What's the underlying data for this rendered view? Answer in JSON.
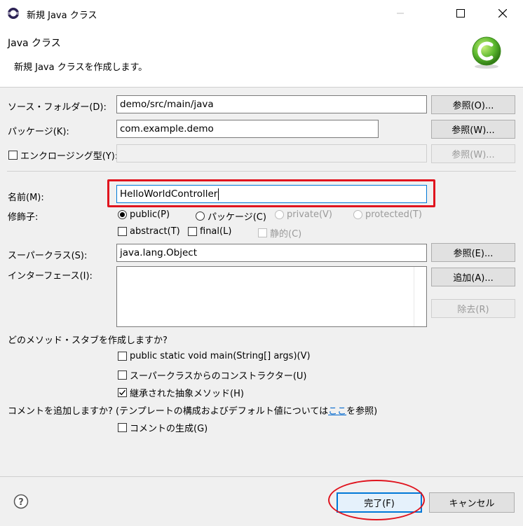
{
  "window": {
    "title": "新規 Java クラス"
  },
  "header": {
    "title": "Java クラス",
    "description": "新規 Java クラスを作成します。"
  },
  "form": {
    "source_folder": {
      "label": "ソース・フォルダー(D):",
      "value": "demo/src/main/java",
      "browse": "参照(O)..."
    },
    "package": {
      "label": "パッケージ(K):",
      "value": "com.example.demo",
      "browse": "参照(W)..."
    },
    "enclosing": {
      "label": "エンクロージング型(Y):",
      "value": "",
      "browse": "参照(W)..."
    },
    "name": {
      "label": "名前(M):",
      "value": "HelloWorldController"
    },
    "modifiers": {
      "label": "修飾子:",
      "public": "public(P)",
      "package": "パッケージ(C)",
      "private": "private(V)",
      "protected": "protected(T)",
      "abstract": "abstract(T)",
      "final": "final(L)",
      "static": "静的(C)"
    },
    "superclass": {
      "label": "スーパークラス(S):",
      "value": "java.lang.Object",
      "browse": "参照(E)..."
    },
    "interfaces": {
      "label": "インターフェース(I):",
      "add": "追加(A)...",
      "remove": "除去(R)"
    },
    "stubs": {
      "question": "どのメソッド・スタブを作成しますか?",
      "main": "public static void main(String[] args)(V)",
      "constructors": "スーパークラスからのコンストラクター(U)",
      "inherited": "継承された抽象メソッド(H)"
    },
    "comments": {
      "question_prefix": "コメントを追加しますか? (テンプレートの構成およびデフォルト値については",
      "link": "ここ",
      "question_suffix": "を参照)",
      "generate": "コメントの生成(G)"
    }
  },
  "footer": {
    "finish": "完了(F)",
    "cancel": "キャンセル"
  },
  "colors": {
    "highlight": "#e0141e",
    "link": "#0066cc"
  },
  "icons": [
    "eclipse-icon",
    "minimize-icon",
    "maximize-icon",
    "close-icon",
    "class-wizard-icon",
    "help-icon",
    "checkmark-icon"
  ]
}
